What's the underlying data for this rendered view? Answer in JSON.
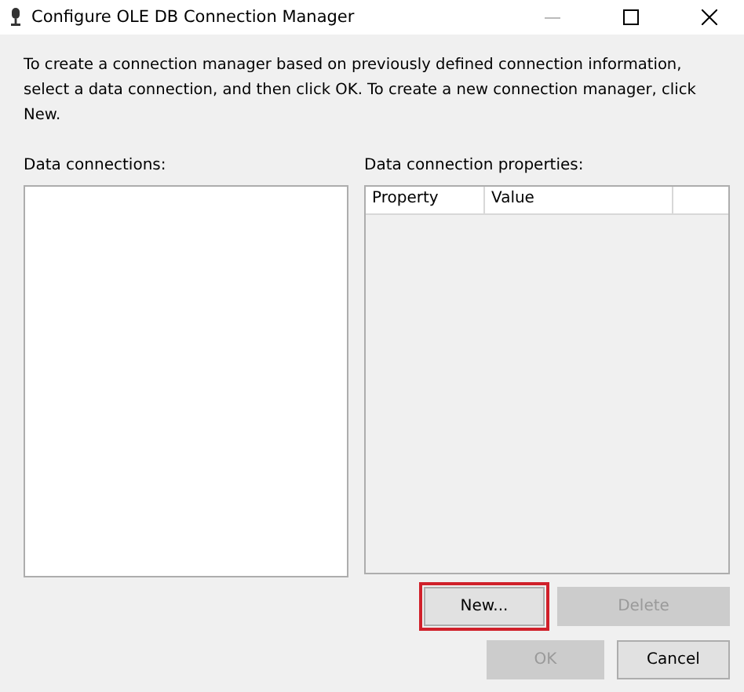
{
  "window": {
    "title": "Configure OLE DB Connection Manager"
  },
  "instructions": "To create a connection manager based on previously defined connection information, select a data connection, and then click OK. To create a new connection manager, click New.",
  "data_connections": {
    "label": "Data connections:"
  },
  "properties": {
    "label": "Data connection properties:",
    "columns": [
      "Property",
      "Value"
    ]
  },
  "list_buttons": [
    {
      "label": "New...",
      "disabled": false,
      "highlighted": true
    },
    {
      "label": "Delete",
      "disabled": true,
      "highlighted": false
    }
  ],
  "dialog_buttons": [
    {
      "label": "OK",
      "disabled": true,
      "highlighted": false
    },
    {
      "label": "Cancel",
      "disabled": false,
      "highlighted": false
    }
  ]
}
